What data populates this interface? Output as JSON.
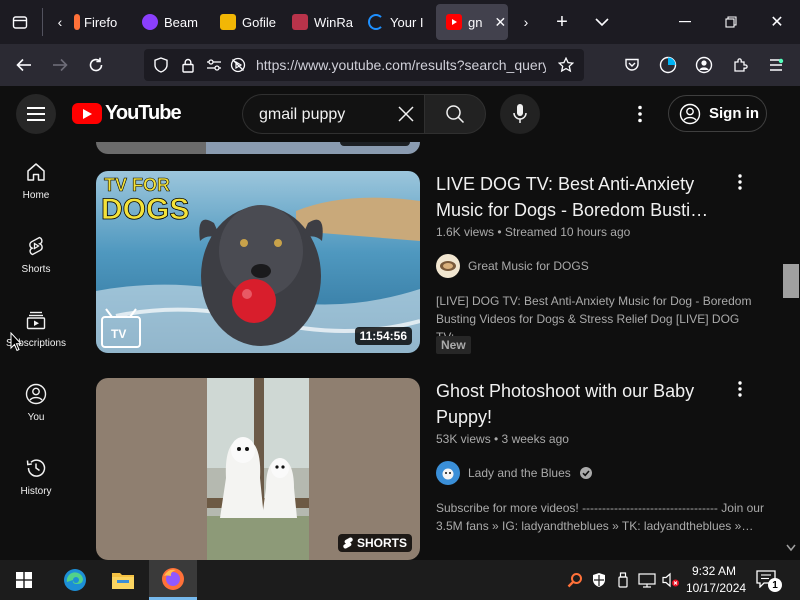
{
  "browser": {
    "tabs": [
      {
        "label": "Firefo",
        "favicon_color": "#ff7139"
      },
      {
        "label": "Beam",
        "favicon_color": "#8a3ffc"
      },
      {
        "label": "Gofile",
        "favicon_color": "#f2b705"
      },
      {
        "label": "WinRa",
        "favicon_color": "#b8334a"
      },
      {
        "label": "Your I",
        "favicon_color": "#1e90ff"
      },
      {
        "label": "gn",
        "favicon_color": "#ff0000"
      }
    ],
    "url": "https://www.youtube.com/results?search_query=gmail+puppy"
  },
  "youtube": {
    "logo_text": "YouTube",
    "search_value": "gmail puppy",
    "signin_label": "Sign in",
    "sidebar": [
      {
        "label": "Home",
        "icon": "home-icon"
      },
      {
        "label": "Shorts",
        "icon": "shorts-icon"
      },
      {
        "label": "Subscriptions",
        "icon": "subscriptions-icon"
      },
      {
        "label": "You",
        "icon": "you-icon"
      },
      {
        "label": "History",
        "icon": "history-icon"
      }
    ],
    "videos": [
      {
        "title": "LIVE DOG TV: Best Anti-Anxiety Music for Dogs - Boredom Busti…",
        "meta": "1.6K views • Streamed 10 hours ago",
        "channel": "Great Music for DOGS",
        "verified": false,
        "description": "[LIVE] DOG TV: Best Anti-Anxiety Music for Dog - Boredom Busting Videos for Dogs & Stress Relief Dog [LIVE] DOG TV:…",
        "badge": "New",
        "duration": "11:54:56",
        "thumb_text": "TV FOR DOGS",
        "thumb_tv_label": "TV"
      },
      {
        "title": "Ghost Photoshoot with our Baby Puppy!",
        "meta": "53K views • 3 weeks ago",
        "channel": "Lady and the Blues",
        "verified": true,
        "description": "Subscribe for more videos! ---------------------------------- Join our 3.5M fans » IG: ladyandtheblues » TK: ladyandtheblues »…",
        "duration": "SHORTS"
      }
    ]
  },
  "taskbar": {
    "time": "9:32 AM",
    "date": "10/17/2024",
    "notification_count": "1"
  }
}
